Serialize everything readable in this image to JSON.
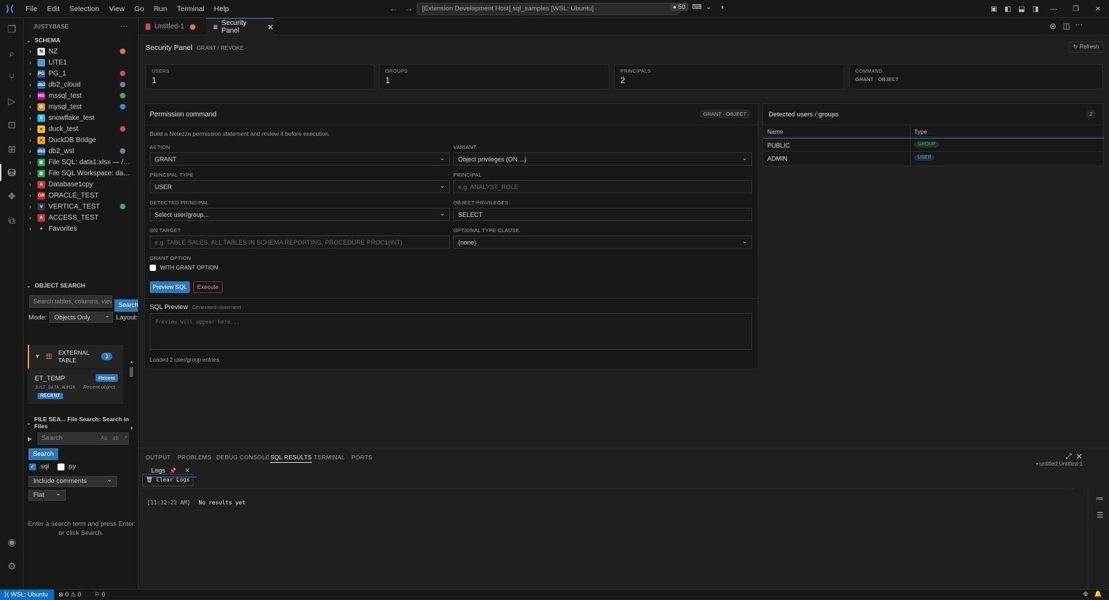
{
  "titlebar": {
    "menu": [
      "File",
      "Edit",
      "Selection",
      "View",
      "Go",
      "Run",
      "Terminal",
      "Help"
    ],
    "search_text": "[Extension Development Host] sql_samples [WSL: Ubuntu]",
    "ext_count": "50"
  },
  "sidebar": {
    "title": "JUSTYBASE",
    "schema_header": "SCHEMA",
    "connections": [
      {
        "label": "NZ",
        "icon_text": "N",
        "icon_color": "#e8e8e8",
        "icon_fg": "#222222",
        "dot": "#e07a30"
      },
      {
        "label": "LITE1",
        "icon_text": "",
        "icon_color": "#4a9cd6",
        "icon_fg": "#ffffff",
        "dot": ""
      },
      {
        "label": "PG_1",
        "icon_text": "PG",
        "icon_color": "#336791",
        "icon_fg": "#ffffff",
        "dot": "#d04a4a"
      },
      {
        "label": "db2_cloud",
        "icon_text": "db2",
        "icon_color": "#1f70c1",
        "icon_fg": "#ffffff",
        "dot": "#7a7aaa"
      },
      {
        "label": "mssql_test",
        "icon_text": "MS",
        "icon_color": "#b0138b",
        "icon_fg": "#ffffff",
        "dot": "#3cae5a"
      },
      {
        "label": "mysql_test",
        "icon_text": "M",
        "icon_color": "#e0922a",
        "icon_fg": "#ffffff",
        "dot": "#2d8fd5"
      },
      {
        "label": "snowflake_test",
        "icon_text": "❄",
        "icon_color": "#29b5e8",
        "icon_fg": "#ffffff",
        "dot": ""
      },
      {
        "label": "duck_test",
        "icon_text": "●",
        "icon_color": "#f2c21b",
        "icon_fg": "#222222",
        "dot": "#d04a4a"
      },
      {
        "label": "DuckDB Bridge",
        "icon_text": "●",
        "icon_color": "#f2a21b",
        "icon_fg": "#222222",
        "dot": ""
      },
      {
        "label": "db2_wsl",
        "icon_text": "db2",
        "icon_color": "#1f70c1",
        "icon_fg": "#ffffff",
        "dot": "#7a7aaa"
      },
      {
        "label": "File SQL: data1.xlsx — /ho...",
        "icon_text": "▦",
        "icon_color": "#2e9a4f",
        "icon_fg": "#ffffff",
        "dot": ""
      },
      {
        "label": "File SQL Workspace: data1...",
        "icon_text": "▦",
        "icon_color": "#2e9a4f",
        "icon_fg": "#ffffff",
        "dot": ""
      },
      {
        "label": "Database1cpy",
        "icon_text": "A",
        "icon_color": "#c23b3b",
        "icon_fg": "#ffffff",
        "dot": ""
      },
      {
        "label": "ORACLE_TEST",
        "icon_text": "OR",
        "icon_color": "#e02020",
        "icon_fg": "#ffffff",
        "dot": ""
      },
      {
        "label": "VERTICA_TEST",
        "icon_text": "V",
        "icon_color": "#2b3a55",
        "icon_fg": "#ffffff",
        "dot": "#3cae5a"
      },
      {
        "label": "ACCESS_TEST",
        "icon_text": "A",
        "icon_color": "#c23b3b",
        "icon_fg": "#ffffff",
        "dot": ""
      },
      {
        "label": "Favorites",
        "icon_text": "★",
        "icon_color": "transparent",
        "icon_fg": "#e8b84a",
        "dot": ""
      }
    ],
    "object_search": {
      "header": "OBJECT SEARCH",
      "placeholder": "Search tables, columns, view",
      "search_btn": "Search",
      "mode_label": "Mode:",
      "mode_value": "Objects Only",
      "layout_label": "Layout:",
      "group_title": "EXTERNAL TABLE",
      "group_count": "1",
      "item_name": "ET_TEMP",
      "item_badge": "Recent",
      "item_path": "JUST_DATA.ADMIN",
      "item_desc": "Recent object",
      "item_tag": "RECENT"
    },
    "file_search": {
      "header": "FILE SEA... File Search: Search in Files",
      "placeholder": "Search",
      "opt_case": "Aa",
      "opt_word": "ab",
      "opt_regex": ".*",
      "search_btn": "Search",
      "ext_sql": ".sql",
      "ext_py": ".py",
      "comments_select": "Include comments",
      "view_select": "Flat",
      "hint": "Enter a search term and press Enter or click Search."
    }
  },
  "tabs": [
    {
      "label": "Untitled-1"
    },
    {
      "label": "Security Panel"
    }
  ],
  "panel": {
    "title": "Security Panel",
    "subtitle": "GRANT / REVOKE",
    "refresh": "↻ Refresh",
    "stats": [
      {
        "label": "USERS",
        "value": "1"
      },
      {
        "label": "GROUPS",
        "value": "1"
      },
      {
        "label": "PRINCIPALS",
        "value": "2"
      },
      {
        "label": "COMMAND",
        "value": "GRANT · OBJECT"
      }
    ],
    "form": {
      "title": "Permission command",
      "badge": "GRANT · OBJECT",
      "desc": "Build a Netezza permission statement and review it before execution.",
      "action_label": "ACTION",
      "action_value": "GRANT",
      "variant_label": "VARIANT",
      "variant_value": "Object privileges (ON ...)",
      "ptype_label": "PRINCIPAL TYPE",
      "ptype_value": "USER",
      "principal_label": "PRINCIPAL",
      "principal_placeholder": "e.g. ANALYST_ROLE",
      "detected_label": "DETECTED PRINCIPAL",
      "detected_value": "Select user/group...",
      "privs_label": "OBJECT PRIVILEGES",
      "privs_value": "SELECT",
      "target_label": "ON TARGET",
      "target_placeholder": "e.g. TABLE SALES, ALL TABLES IN SCHEMA REPORTING, PROCEDURE PROC1(INT)",
      "typeclause_label": "OPTIONAL TYPE CLAUSE",
      "typeclause_value": "(none)",
      "grantopt_label": "GRANT OPTION",
      "grantopt_check": "WITH GRANT OPTION",
      "preview_btn": "Preview SQL",
      "execute_btn": "Execute",
      "sql_title": "SQL Preview",
      "sql_sub": "Generated statement",
      "sql_placeholder": "Preview will appear here...",
      "footer": "Loaded 2 user/group entries."
    },
    "detected": {
      "title": "Detected users / groups",
      "count": "2",
      "col_name": "Name",
      "col_type": "Type",
      "rows": [
        {
          "name": "PUBLIC",
          "type": "GROUP",
          "color": "#3cae5a"
        },
        {
          "name": "ADMIN",
          "type": "USER",
          "color": "#4a9cd6"
        }
      ]
    }
  },
  "bottom": {
    "tabs": [
      "OUTPUT",
      "PROBLEMS",
      "DEBUG CONSOLE",
      "SQL RESULTS",
      "TERMINAL",
      "PORTS"
    ],
    "subtab": "Logs",
    "right_info": "• untitled:Untitled-1",
    "clear_btn": "🗑 Clear Logs",
    "log_time": "[11:32:22 AM]",
    "log_text": "No results yet"
  },
  "status": {
    "remote": "WSL: Ubuntu",
    "problems": "⊗ 0 ⚠ 0",
    "ports": "⚐ 0"
  }
}
